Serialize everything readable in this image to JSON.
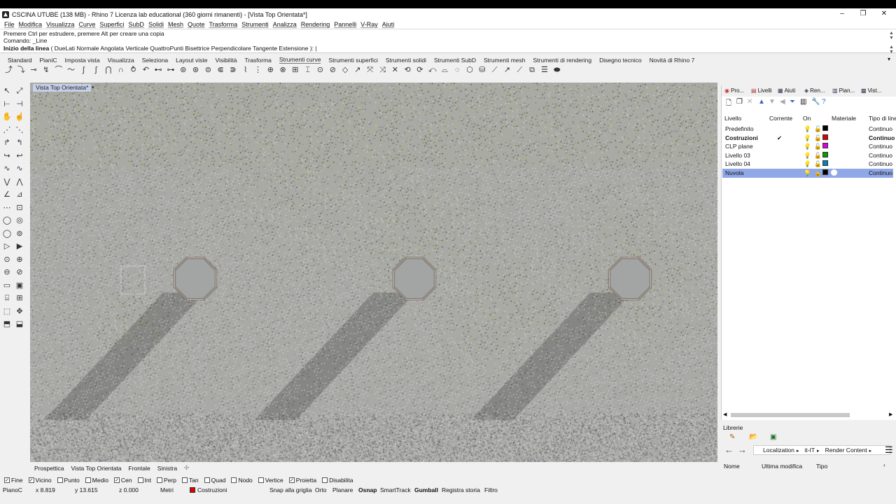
{
  "window": {
    "title": "CSCINA UTUBE (138 MB) - Rhino 7 Licenza lab educational (360 giorni rimanenti) - [Vista Top Orientata*]",
    "minimize": "–",
    "restore": "❐",
    "close": "✕"
  },
  "menu": [
    "File",
    "Modifica",
    "Visualizza",
    "Curve",
    "Superfici",
    "SubD",
    "Solidi",
    "Mesh",
    "Quote",
    "Trasforma",
    "Strumenti",
    "Analizza",
    "Rendering",
    "Pannelli",
    "V-Ray",
    "Aiuti"
  ],
  "command": {
    "history1": "Premere Ctrl per estrudere, premere Alt per creare una copia",
    "history2": "Comando: _Line",
    "prompt_label": "Inizio della linea",
    "prompt_options": "( DueLati  Normale  Angolata  Verticale  QuattroPunti  Bisettrice  Perpendicolare  Tangente  Estensione ):"
  },
  "toolbar_tabs": [
    "Standard",
    "PianiC",
    "Imposta vista",
    "Visualizza",
    "Seleziona",
    "Layout viste",
    "Visibilità",
    "Trasforma",
    "Strumenti curve",
    "Strumenti superfici",
    "Strumenti solidi",
    "Strumenti SubD",
    "Strumenti mesh",
    "Strumenti di rendering",
    "Disegno tecnico",
    "Novità di Rhino 7"
  ],
  "toolbar_tabs_active": "Strumenti curve",
  "viewport": {
    "label": "Vista Top Orientata*",
    "dropdown": "▾"
  },
  "viewport_tabs": [
    "Prospettica",
    "Vista Top Orientata",
    "Frontale",
    "Sinistra"
  ],
  "viewport_tabs_add": "✣",
  "osnap": [
    {
      "label": "Fine",
      "checked": true
    },
    {
      "label": "Vicino",
      "checked": true
    },
    {
      "label": "Punto",
      "checked": false
    },
    {
      "label": "Medio",
      "checked": false
    },
    {
      "label": "Cen",
      "checked": true
    },
    {
      "label": "Int",
      "checked": false
    },
    {
      "label": "Perp",
      "checked": false
    },
    {
      "label": "Tan",
      "checked": false
    },
    {
      "label": "Quad",
      "checked": false
    },
    {
      "label": "Nodo",
      "checked": false
    },
    {
      "label": "Vertice",
      "checked": false
    },
    {
      "label": "Proietta",
      "checked": true
    },
    {
      "label": "Disabilita",
      "checked": false
    }
  ],
  "status": {
    "plane": "PianoC",
    "x": "x 8.819",
    "y": "y 13.615",
    "z": "z 0.000",
    "units": "Metri",
    "layer": "Costruzioni",
    "layer_color": "#e00000",
    "toggles": [
      "Snap alla griglia",
      "Orto",
      "Planare",
      "Osnap",
      "SmartTrack",
      "Gumball",
      "Registra storia",
      "Filtro"
    ],
    "bold_toggles": [
      "Osnap",
      "Gumball"
    ]
  },
  "panel": {
    "tabs": [
      "Pro...",
      "Livelli",
      "Aiuti",
      "Ren...",
      "Pian...",
      "Vist..."
    ],
    "headers": {
      "name": "Livello",
      "current": "Corrente",
      "on": "On",
      "material": "Materiale",
      "linetype": "Tipo di line"
    },
    "layers": [
      {
        "name": "Predefinito",
        "current": "",
        "color": "#000000",
        "linetype": "Continuo",
        "bold": false,
        "selected": false
      },
      {
        "name": "Costruzioni",
        "current": "✔",
        "color": "#e00000",
        "linetype": "Continuo",
        "bold": true,
        "selected": false
      },
      {
        "name": "CLP plane",
        "current": "",
        "color": "#e000e0",
        "linetype": "Continuo",
        "bold": false,
        "selected": false
      },
      {
        "name": "Livello 03",
        "current": "",
        "color": "#00a000",
        "linetype": "Continuo",
        "bold": false,
        "selected": false
      },
      {
        "name": "Livello 04",
        "current": "",
        "color": "#0080c0",
        "linetype": "Continuo",
        "bold": false,
        "selected": false
      },
      {
        "name": "Nuvola",
        "current": "",
        "color": "#000000",
        "linetype": "Continuo",
        "bold": false,
        "selected": true
      }
    ]
  },
  "libraries": {
    "title": "Librerie",
    "breadcrumb": [
      "Localization",
      "it-IT",
      "Render Content"
    ],
    "columns": [
      "Nome",
      "Ultima modifica",
      "Tipo"
    ]
  }
}
